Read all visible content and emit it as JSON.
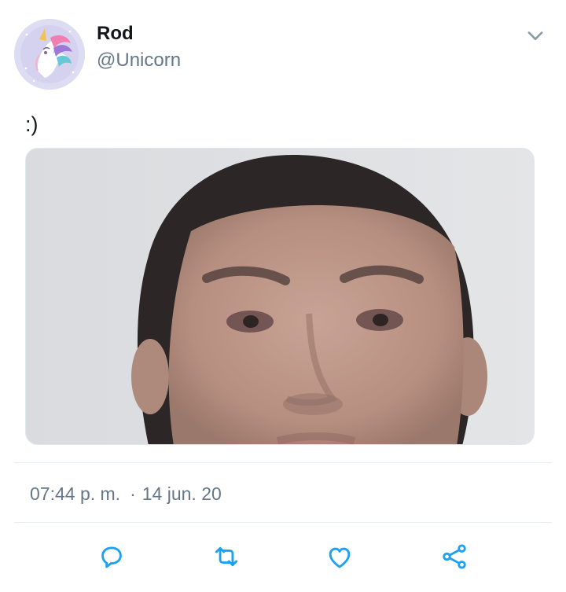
{
  "tweet": {
    "author": {
      "display_name": "Rod",
      "handle": "@Unicorn",
      "avatar_icon": "unicorn-avatar-icon"
    },
    "text": ":)",
    "media": {
      "kind": "photo"
    },
    "timestamp": {
      "time": "07:44 p. m.",
      "separator": "·",
      "date": "14 jun. 20"
    },
    "actions": [
      {
        "name": "reply",
        "icon": "reply-icon"
      },
      {
        "name": "retweet",
        "icon": "retweet-icon"
      },
      {
        "name": "like",
        "icon": "like-icon"
      },
      {
        "name": "share",
        "icon": "share-icon"
      }
    ]
  },
  "colors": {
    "primary_text": "#14171a",
    "secondary_text": "#657786",
    "icon": "#1da1f2",
    "divider": "#e6ecf0",
    "avatar_bg": "#dcdcf3"
  }
}
